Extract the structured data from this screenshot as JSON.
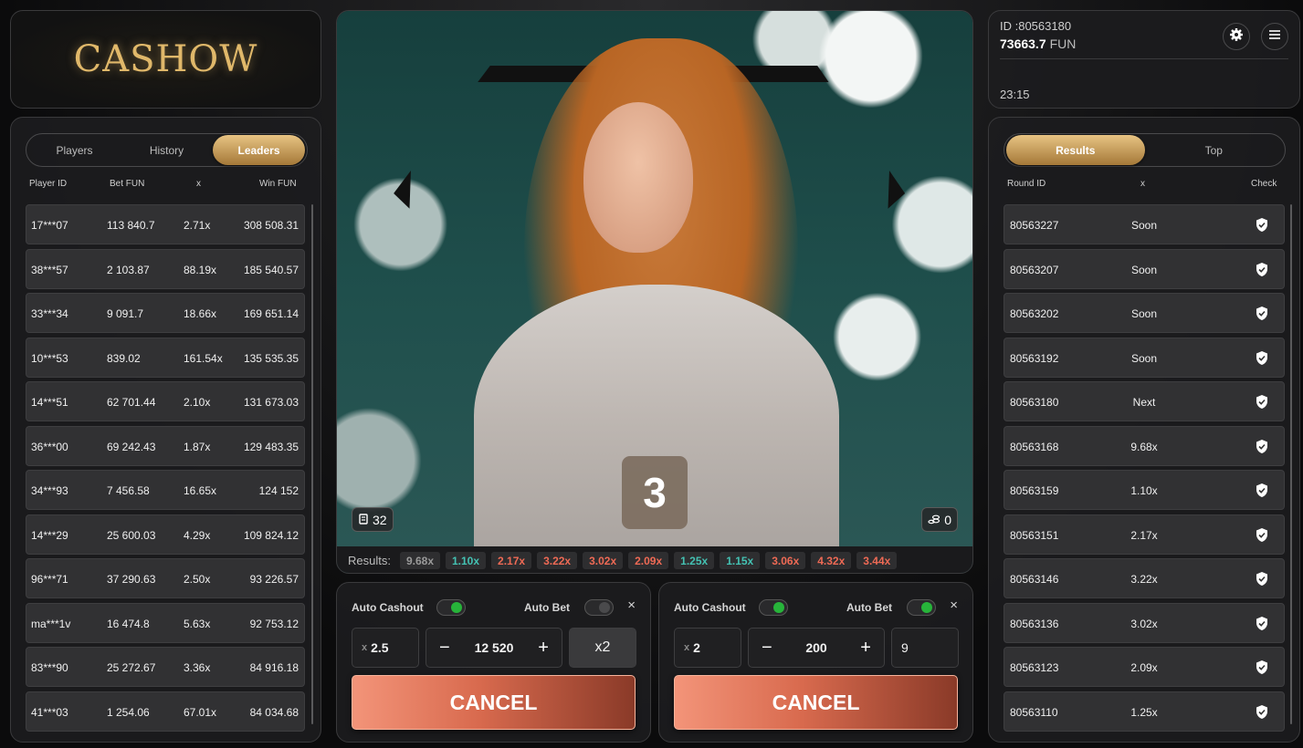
{
  "brand": {
    "logo_text": "CASHOW"
  },
  "left_tabs": [
    {
      "label": "Players",
      "active": false
    },
    {
      "label": "History",
      "active": false
    },
    {
      "label": "Leaders",
      "active": true
    }
  ],
  "leaders": {
    "headers": {
      "player_id": "Player ID",
      "bet": "Bet  FUN",
      "x": "x",
      "win": "Win  FUN"
    },
    "rows": [
      {
        "player": "17***07",
        "bet": "113 840.7",
        "x": "2.71x",
        "win": "308 508.31"
      },
      {
        "player": "38***57",
        "bet": "2 103.87",
        "x": "88.19x",
        "win": "185 540.57"
      },
      {
        "player": "33***34",
        "bet": "9 091.7",
        "x": "18.66x",
        "win": "169 651.14"
      },
      {
        "player": "10***53",
        "bet": "839.02",
        "x": "161.54x",
        "win": "135 535.35"
      },
      {
        "player": "14***51",
        "bet": "62 701.44",
        "x": "2.10x",
        "win": "131 673.03"
      },
      {
        "player": "36***00",
        "bet": "69 242.43",
        "x": "1.87x",
        "win": "129 483.35"
      },
      {
        "player": "34***93",
        "bet": "7 456.58",
        "x": "16.65x",
        "win": "124 152"
      },
      {
        "player": "14***29",
        "bet": "25 600.03",
        "x": "4.29x",
        "win": "109 824.12"
      },
      {
        "player": "96***71",
        "bet": "37 290.63",
        "x": "2.50x",
        "win": "93 226.57"
      },
      {
        "player": "ma***1v",
        "bet": "16 474.8",
        "x": "5.63x",
        "win": "92 753.12"
      },
      {
        "player": "83***90",
        "bet": "25 272.67",
        "x": "3.36x",
        "win": "84 916.18"
      },
      {
        "player": "41***03",
        "bet": "1 254.06",
        "x": "67.01x",
        "win": "84 034.68"
      }
    ]
  },
  "video": {
    "countdown": "3",
    "players_count": "32",
    "bets_count": "0",
    "results_label": "Results:",
    "results": [
      {
        "value": "9.68x",
        "tone": "grey"
      },
      {
        "value": "1.10x",
        "tone": "teal"
      },
      {
        "value": "2.17x",
        "tone": "red"
      },
      {
        "value": "3.22x",
        "tone": "red"
      },
      {
        "value": "3.02x",
        "tone": "red"
      },
      {
        "value": "2.09x",
        "tone": "red"
      },
      {
        "value": "1.25x",
        "tone": "teal"
      },
      {
        "value": "1.15x",
        "tone": "teal"
      },
      {
        "value": "3.06x",
        "tone": "red"
      },
      {
        "value": "4.32x",
        "tone": "red"
      },
      {
        "value": "3.44x",
        "tone": "red"
      }
    ]
  },
  "account": {
    "id": "ID :80563180",
    "balance": "73663.7",
    "currency": "FUN",
    "time": "23:15"
  },
  "right_tabs": [
    {
      "label": "Results",
      "active": true
    },
    {
      "label": "Top",
      "active": false
    }
  ],
  "results_table": {
    "headers": {
      "round": "Round ID",
      "x": "x",
      "check": "Check"
    },
    "rows": [
      {
        "round": "80563227",
        "x": "Soon"
      },
      {
        "round": "80563207",
        "x": "Soon"
      },
      {
        "round": "80563202",
        "x": "Soon"
      },
      {
        "round": "80563192",
        "x": "Soon"
      },
      {
        "round": "80563180",
        "x": "Next"
      },
      {
        "round": "80563168",
        "x": "9.68x"
      },
      {
        "round": "80563159",
        "x": "1.10x"
      },
      {
        "round": "80563151",
        "x": "2.17x"
      },
      {
        "round": "80563146",
        "x": "3.22x"
      },
      {
        "round": "80563136",
        "x": "3.02x"
      },
      {
        "round": "80563123",
        "x": "2.09x"
      },
      {
        "round": "80563110",
        "x": "1.25x"
      }
    ]
  },
  "bets": [
    {
      "auto_cashout_label": "Auto Cashout",
      "auto_cashout_on": true,
      "auto_bet_label": "Auto Bet",
      "auto_bet_on": false,
      "close": "×",
      "cashout_prefix": "x",
      "cashout_value": "2.5",
      "minus": "−",
      "amount": "12 520",
      "plus": "+",
      "extra": "x2",
      "cancel_label": "CANCEL"
    },
    {
      "auto_cashout_label": "Auto Cashout",
      "auto_cashout_on": true,
      "auto_bet_label": "Auto Bet",
      "auto_bet_on": true,
      "close": "×",
      "cashout_prefix": "x",
      "cashout_value": "2",
      "minus": "−",
      "amount": "200",
      "plus": "+",
      "extra": "9",
      "cancel_label": "CANCEL"
    }
  ],
  "colors": {
    "accent_gold": "#c89a55",
    "cancel": "#e07a5f",
    "teal": "#44c2b3",
    "red": "#ef6a55",
    "toggle_on": "#27b43a"
  }
}
